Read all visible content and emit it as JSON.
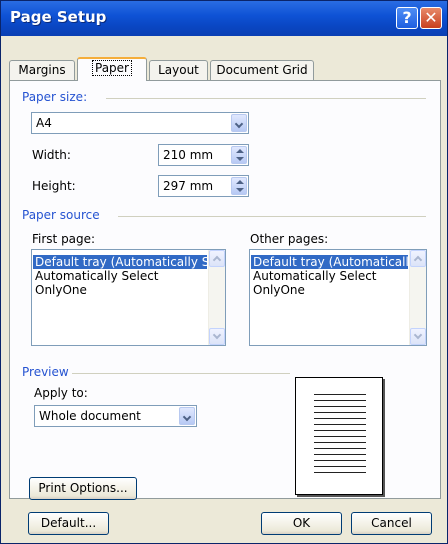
{
  "window": {
    "title": "Page Setup"
  },
  "tabs": [
    {
      "label": "Margins",
      "active": false
    },
    {
      "label": "Paper",
      "active": true
    },
    {
      "label": "Layout",
      "active": false
    },
    {
      "label": "Document Grid",
      "active": false
    }
  ],
  "paper_size": {
    "group_label": "Paper size:",
    "selected": "A4",
    "width_label": "Width:",
    "width_value": "210 mm",
    "height_label": "Height:",
    "height_value": "297 mm"
  },
  "paper_source": {
    "group_label": "Paper source",
    "first_page_label": "First page:",
    "other_pages_label": "Other pages:",
    "first_page_items": [
      "Default tray (Automatically S",
      "Automatically Select",
      "OnlyOne"
    ],
    "other_pages_items": [
      "Default tray (Automatically S",
      "Automatically Select",
      "OnlyOne"
    ],
    "selected_index": 0
  },
  "preview": {
    "group_label": "Preview",
    "apply_to_label": "Apply to:",
    "apply_to_value": "Whole document"
  },
  "buttons": {
    "print_options": "Print Options...",
    "default": "Default...",
    "ok": "OK",
    "cancel": "Cancel"
  },
  "colors": {
    "titlebar": "#0a47c4",
    "group_label": "#2553d1",
    "selection": "#316ac5",
    "dialog_bg": "#ece9d8"
  }
}
